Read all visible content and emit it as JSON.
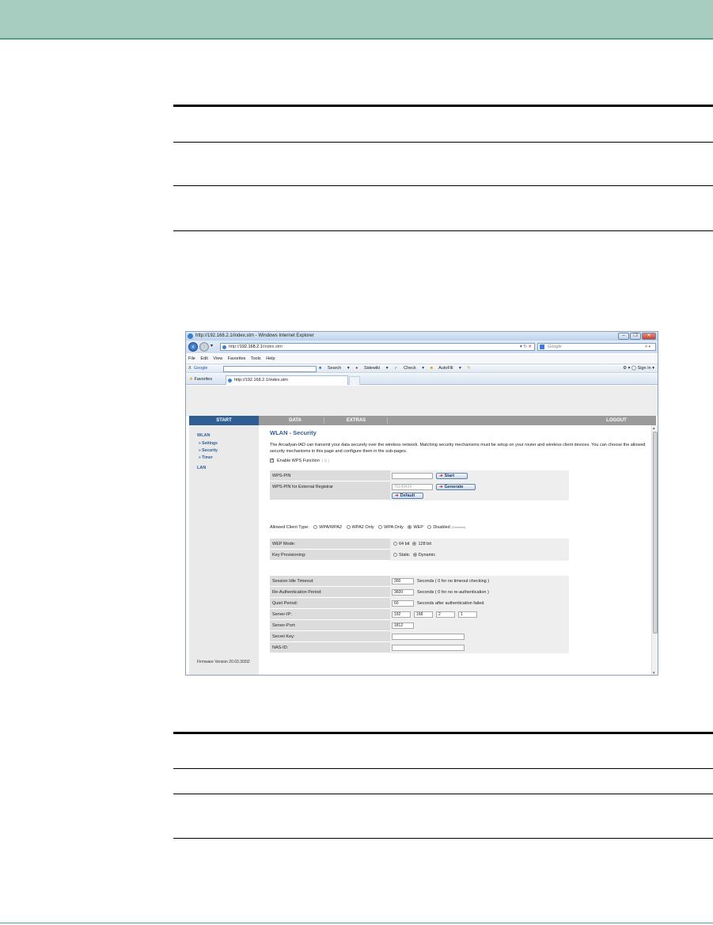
{
  "browser": {
    "window_title": "http://192.168.2.1/index.stm - Windows Internet Explorer",
    "url_prefix": "http://",
    "url_host": "192.168.2.1",
    "url_path": "/index.stm",
    "search_placeholder": "Google",
    "menu": [
      "File",
      "Edit",
      "View",
      "Favorites",
      "Tools",
      "Help"
    ],
    "google_toolbar": {
      "close": "X",
      "logo": "Google",
      "items": [
        "Search",
        "Sidewiki",
        "Check",
        "AutoFill"
      ],
      "sign_in": "Sign In"
    },
    "favorites_label": "Favorites",
    "tab_label": "http://192.168.2.1/index.stm"
  },
  "router": {
    "nav": {
      "start": "START",
      "data": "DATA",
      "extras": "EXTRAS",
      "logout": "LOGOUT"
    },
    "sidebar": {
      "wlan": "WLAN",
      "settings": "» Settings",
      "security": "» Security",
      "timer": "» Timer",
      "lan": "LAN",
      "firmware": "Firmware Version 20.03.302t2"
    },
    "title": "WLAN - Security",
    "intro": "The Arcadyan-IAD can transmit your data securely over the wireless network. Matching security mechanisms must be setup on your router and wireless client devices. You can choose the allowed security mechanisms in this page and configure them in the sub-pages.",
    "wps_function_label": "Enable WPS Function",
    "wps_pin_label": "WPS-PIN",
    "start_btn": "Start",
    "wps_ext_label": "WPS-PIN for External Registrar",
    "wps_ext_value": "76149434",
    "generate_btn": "Generate",
    "default_btn": "Default",
    "client_type_label": "Allowed Client Type:",
    "client_types": [
      "WPA/WPA2",
      "WPA2 Only",
      "WPA Only",
      "WEP",
      "Disabled"
    ],
    "client_type_disabled_note": "(Disabled)",
    "wep_mode_label": "WEP Mode:",
    "wep_64": "64 bit",
    "wep_128": "128 bit",
    "key_prov_label": "Key Provisioning:",
    "static": "Static",
    "dynamic": "Dynamic",
    "session_label": "Session Idle Timeout:",
    "session_value": "300",
    "session_unit": "Seconds ( 0 for no timeout checking )",
    "reauth_label": "Re-Authentication Period:",
    "reauth_value": "3600",
    "reauth_unit": "Seconds ( 0 for no re-authentication )",
    "quiet_label": "Quiet Period:",
    "quiet_value": "60",
    "quiet_unit": "Seconds after authentication failed",
    "server_ip_label": "Server-IP:",
    "ip1": "192",
    "ip2": "168",
    "ip3": "2",
    "ip4": "1",
    "server_port_label": "Server-Port:",
    "server_port_value": "1812",
    "secret_label": "Secret Key:",
    "nas_label": "NAS-ID:"
  }
}
